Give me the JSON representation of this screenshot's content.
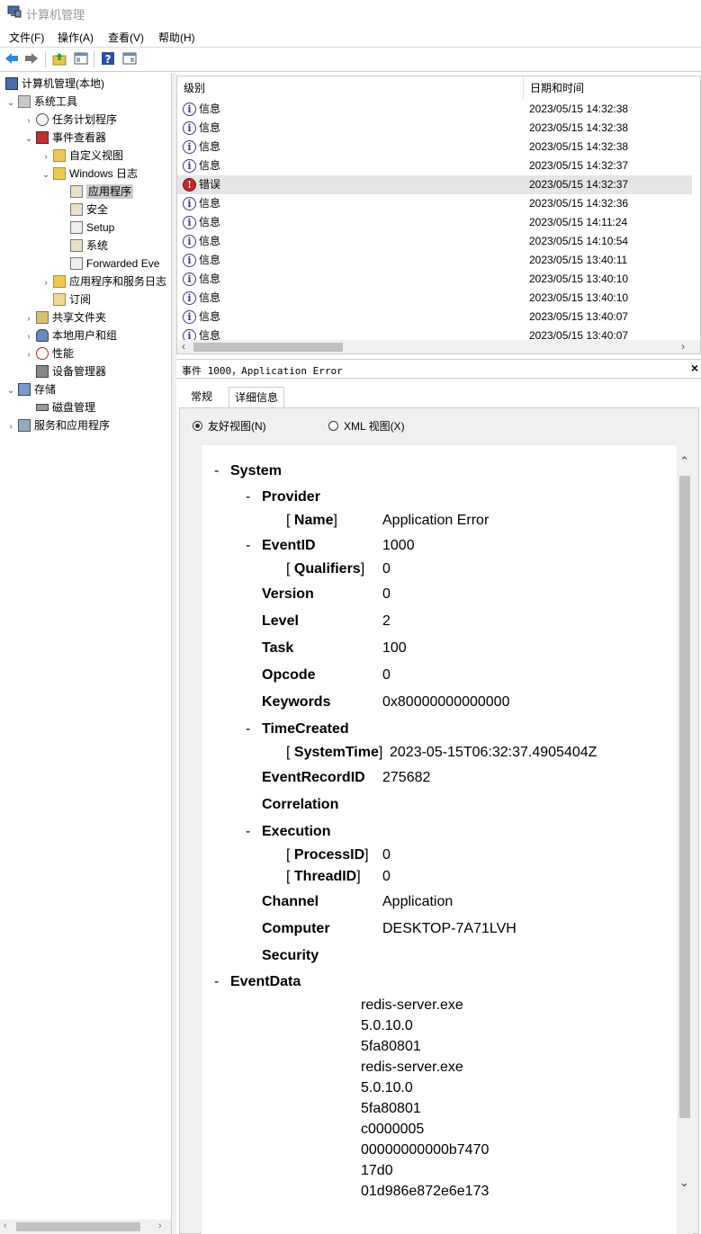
{
  "window": {
    "title": "计算机管理"
  },
  "menu": [
    "文件(F)",
    "操作(A)",
    "查看(V)",
    "帮助(H)"
  ],
  "tree": {
    "items": [
      {
        "label": "计算机管理(本地)",
        "icon": "computer-mgmt-icon"
      },
      {
        "label": "系统工具",
        "icon": "tools-icon"
      },
      {
        "label": "任务计划程序",
        "icon": "clock-icon"
      },
      {
        "label": "事件查看器",
        "icon": "event-viewer-icon"
      },
      {
        "label": "自定义视图",
        "icon": "folder-icon"
      },
      {
        "label": "Windows 日志",
        "icon": "folder-icon"
      },
      {
        "label": "应用程序",
        "icon": "log-icon"
      },
      {
        "label": "安全",
        "icon": "log-icon"
      },
      {
        "label": "Setup",
        "icon": "log-icon"
      },
      {
        "label": "系统",
        "icon": "log-icon"
      },
      {
        "label": "Forwarded Eve",
        "icon": "log-icon"
      },
      {
        "label": "应用程序和服务日志",
        "icon": "folder-icon"
      },
      {
        "label": "订阅",
        "icon": "subscription-icon"
      },
      {
        "label": "共享文件夹",
        "icon": "shared-folder-icon"
      },
      {
        "label": "本地用户和组",
        "icon": "users-icon"
      },
      {
        "label": "性能",
        "icon": "performance-icon"
      },
      {
        "label": "设备管理器",
        "icon": "device-manager-icon"
      },
      {
        "label": "存储",
        "icon": "storage-icon"
      },
      {
        "label": "磁盘管理",
        "icon": "disk-icon"
      },
      {
        "label": "服务和应用程序",
        "icon": "services-icon"
      }
    ]
  },
  "events": {
    "columns": {
      "level": "级别",
      "datetime": "日期和时间"
    },
    "rows": [
      {
        "level": "信息",
        "datetime": "2023/05/15 14:32:38",
        "type": "info"
      },
      {
        "level": "信息",
        "datetime": "2023/05/15 14:32:38",
        "type": "info"
      },
      {
        "level": "信息",
        "datetime": "2023/05/15 14:32:38",
        "type": "info"
      },
      {
        "level": "信息",
        "datetime": "2023/05/15 14:32:37",
        "type": "info"
      },
      {
        "level": "错误",
        "datetime": "2023/05/15 14:32:37",
        "type": "error"
      },
      {
        "level": "信息",
        "datetime": "2023/05/15 14:32:36",
        "type": "info"
      },
      {
        "level": "信息",
        "datetime": "2023/05/15 14:11:24",
        "type": "info"
      },
      {
        "level": "信息",
        "datetime": "2023/05/15 14:10:54",
        "type": "info"
      },
      {
        "level": "信息",
        "datetime": "2023/05/15 13:40:11",
        "type": "info"
      },
      {
        "level": "信息",
        "datetime": "2023/05/15 13:40:10",
        "type": "info"
      },
      {
        "level": "信息",
        "datetime": "2023/05/15 13:40:10",
        "type": "info"
      },
      {
        "level": "信息",
        "datetime": "2023/05/15 13:40:07",
        "type": "info"
      },
      {
        "level": "信息",
        "datetime": "2023/05/15 13:40:07",
        "type": "info"
      }
    ]
  },
  "detail": {
    "header": "事件 1000，Application Error",
    "tabs": [
      "常规",
      "详细信息"
    ],
    "radios": [
      "友好视图(N)",
      "XML 视图(X)"
    ],
    "tree": {
      "system": "System",
      "provider": "Provider",
      "name_key": "Name",
      "name_val": "Application Error",
      "eventid": "EventID",
      "eventid_val": "1000",
      "qualifiers": "Qualifiers",
      "qualifiers_val": "0",
      "version": "Version",
      "version_val": "0",
      "level": "Level",
      "level_val": "2",
      "task": "Task",
      "task_val": "100",
      "opcode": "Opcode",
      "opcode_val": "0",
      "keywords": "Keywords",
      "keywords_val": "0x80000000000000",
      "timecreated": "TimeCreated",
      "systemtime": "SystemTime",
      "systemtime_val": "2023-05-15T06:32:37.4905404Z",
      "eventrecordid": "EventRecordID",
      "eventrecordid_val": "275682",
      "correlation": "Correlation",
      "execution": "Execution",
      "processid": "ProcessID",
      "processid_val": "0",
      "threadid": "ThreadID",
      "threadid_val": "0",
      "channel": "Channel",
      "channel_val": "Application",
      "computer": "Computer",
      "computer_val": "DESKTOP-7A71LVH",
      "security": "Security",
      "eventdata": "EventData",
      "eventdata_values": [
        "redis-server.exe",
        "5.0.10.0",
        "5fa80801",
        "redis-server.exe",
        "5.0.10.0",
        "5fa80801",
        "c0000005",
        "00000000000b7470",
        "17d0",
        "01d986e872e6e173"
      ]
    }
  }
}
